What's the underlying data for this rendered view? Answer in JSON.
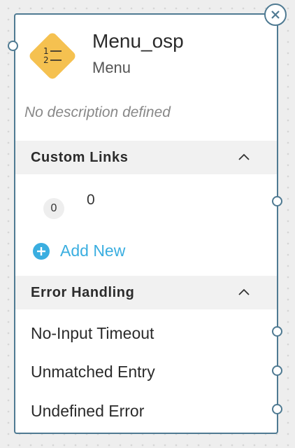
{
  "node": {
    "title": "Menu_osp",
    "type": "Menu",
    "description": "No description defined",
    "icon": "menu-list-icon",
    "colors": {
      "icon_fill": "#f5c150",
      "border": "#4f7a92",
      "accent": "#3aaee0"
    }
  },
  "custom_links": {
    "title": "Custom Links",
    "items": [
      {
        "badge": "0",
        "label": "0"
      }
    ],
    "add_label": "Add New"
  },
  "error_handling": {
    "title": "Error Handling",
    "items": [
      "No-Input Timeout",
      "Unmatched Entry",
      "Undefined Error"
    ]
  }
}
